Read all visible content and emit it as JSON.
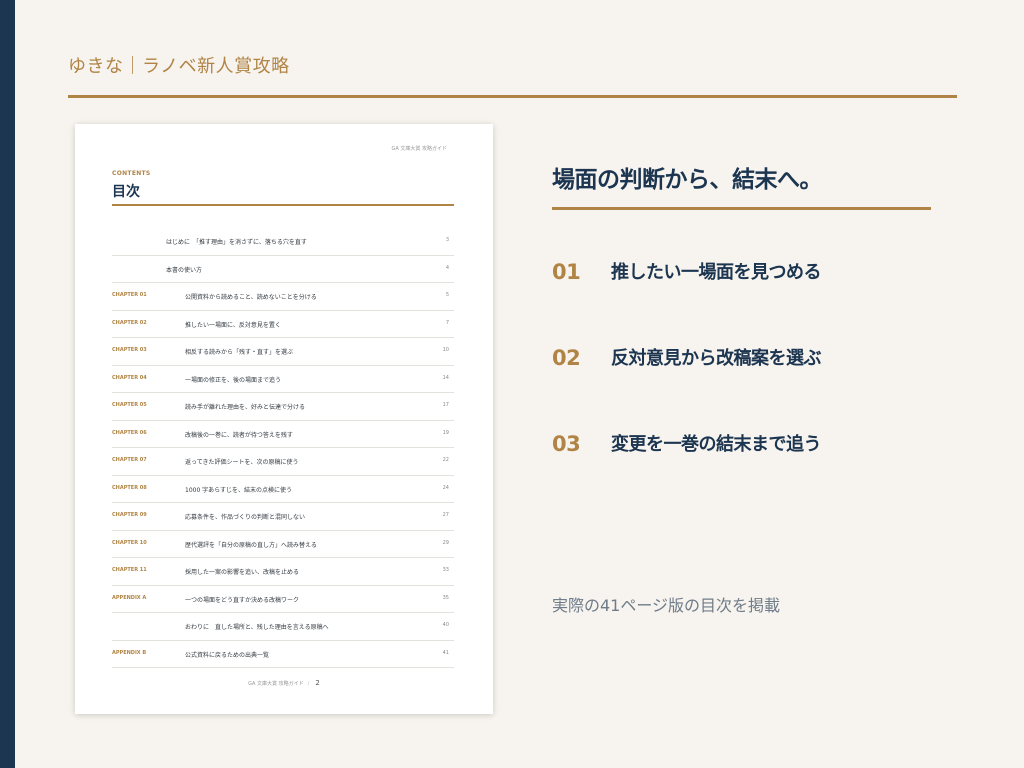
{
  "header": {
    "title": "ゆきな｜ラノベ新人賞攻略"
  },
  "document_page": {
    "running_head": "GA 文庫大賞 攻略ガイド",
    "kicker": "CONTENTS",
    "title": "目次",
    "toc": [
      {
        "label": "",
        "text": "はじめに　「推す理由」を消さずに、落ちる穴を直す",
        "page": "3",
        "indent": "front"
      },
      {
        "label": "",
        "text": "本書の使い方",
        "page": "4",
        "indent": "front"
      },
      {
        "label": "CHAPTER 01",
        "text": "公開資料から読めること、読めないことを分ける",
        "page": "5",
        "indent": "chap"
      },
      {
        "label": "CHAPTER 02",
        "text": "推したい一場面に、反対意見を置く",
        "page": "7",
        "indent": "chap"
      },
      {
        "label": "CHAPTER 03",
        "text": "相反する読みから「残す・直す」を選ぶ",
        "page": "10",
        "indent": "chap"
      },
      {
        "label": "CHAPTER 04",
        "text": "一場面の修正を、後の場面まで追う",
        "page": "14",
        "indent": "chap"
      },
      {
        "label": "CHAPTER 05",
        "text": "読み手が離れた理由を、好みと伝達で分ける",
        "page": "17",
        "indent": "chap"
      },
      {
        "label": "CHAPTER 06",
        "text": "改稿後の一巻に、読者が待つ答えを残す",
        "page": "19",
        "indent": "chap"
      },
      {
        "label": "CHAPTER 07",
        "text": "返ってきた評価シートを、次の原稿に使う",
        "page": "22",
        "indent": "chap"
      },
      {
        "label": "CHAPTER 08",
        "text": "1000 字あらすじを、結末の点検に使う",
        "page": "24",
        "indent": "chap"
      },
      {
        "label": "CHAPTER 09",
        "text": "応募条件を、作品づくりの判断と混同しない",
        "page": "27",
        "indent": "chap"
      },
      {
        "label": "CHAPTER 10",
        "text": "歴代選評を「自分の原稿の直し方」へ読み替える",
        "page": "29",
        "indent": "chap"
      },
      {
        "label": "CHAPTER 11",
        "text": "採用した一案の影響を追い、改稿を止める",
        "page": "33",
        "indent": "chap"
      },
      {
        "label": "APPENDIX A",
        "text": "一つの場面をどう直すか決める改稿ワーク",
        "page": "35",
        "indent": "chap"
      },
      {
        "label": "",
        "text": "おわりに　直した場所と、残した理由を言える原稿へ",
        "page": "40",
        "indent": "chap"
      },
      {
        "label": "APPENDIX B",
        "text": "公式資料に戻るための出典一覧",
        "page": "41",
        "indent": "chap"
      }
    ],
    "footer": {
      "text": "GA 文庫大賞 攻略ガイド",
      "separator": "/",
      "page_number": "2"
    }
  },
  "main": {
    "heading": "場面の判断から、結末へ。",
    "points": [
      {
        "num": "01",
        "text": "推したい一場面を見つめる"
      },
      {
        "num": "02",
        "text": "反対意見から改稿案を選ぶ"
      },
      {
        "num": "03",
        "text": "変更を一巻の結末まで追う"
      }
    ],
    "note": "実際の41ページ版の目次を掲載"
  },
  "colors": {
    "navy": "#1c3550",
    "gold": "#b08445",
    "background": "#f7f3ee"
  }
}
